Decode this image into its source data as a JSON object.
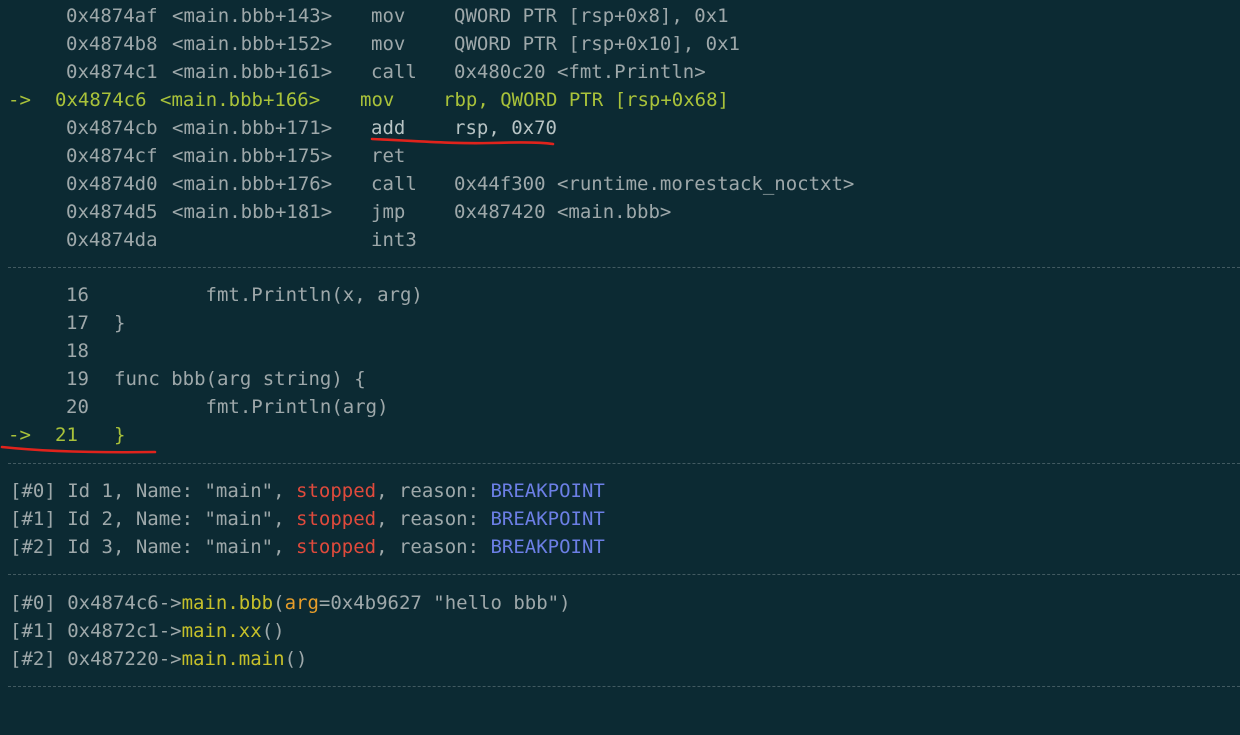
{
  "disasm": [
    {
      "arrow": "",
      "addr": "0x4874af",
      "sym": "<main.bbb+143>",
      "op": "mov",
      "args": "QWORD PTR [rsp+0x8], 0x1"
    },
    {
      "arrow": "",
      "addr": "0x4874b8",
      "sym": "<main.bbb+152>",
      "op": "mov",
      "args": "QWORD PTR [rsp+0x10], 0x1"
    },
    {
      "arrow": "",
      "addr": "0x4874c1",
      "sym": "<main.bbb+161>",
      "op": "call",
      "args": "0x480c20 <fmt.Println>"
    },
    {
      "arrow": "->",
      "addr": "0x4874c6",
      "sym": "<main.bbb+166>",
      "op": "mov",
      "args": "rbp, QWORD PTR [rsp+0x68]"
    },
    {
      "arrow": "",
      "addr": "0x4874cb",
      "sym": "<main.bbb+171>",
      "op": "add",
      "args": "rsp, 0x70"
    },
    {
      "arrow": "",
      "addr": "0x4874cf",
      "sym": "<main.bbb+175>",
      "op": "ret",
      "args": ""
    },
    {
      "arrow": "",
      "addr": "0x4874d0",
      "sym": "<main.bbb+176>",
      "op": "call",
      "args": "0x44f300 <runtime.morestack_noctxt>"
    },
    {
      "arrow": "",
      "addr": "0x4874d5",
      "sym": "<main.bbb+181>",
      "op": "jmp",
      "args": "0x487420 <main.bbb>"
    },
    {
      "arrow": "",
      "addr": "0x4874da",
      "sym": "",
      "op": "int3",
      "args": ""
    }
  ],
  "source": [
    {
      "arrow": "",
      "num": "16",
      "code": "        fmt.Println(x, arg)"
    },
    {
      "arrow": "",
      "num": "17",
      "code": "}"
    },
    {
      "arrow": "",
      "num": "18",
      "code": ""
    },
    {
      "arrow": "",
      "num": "19",
      "code": "func bbb(arg string) {"
    },
    {
      "arrow": "",
      "num": "20",
      "code": "        fmt.Println(arg)"
    },
    {
      "arrow": "->",
      "num": "21",
      "code": "}"
    }
  ],
  "threads": [
    {
      "idx": "[#0]",
      "id": "Id 1, Name: \"main\", ",
      "state": "stopped",
      "mid": ", reason: ",
      "reason": "BREAKPOINT"
    },
    {
      "idx": "[#1]",
      "id": "Id 2, Name: \"main\", ",
      "state": "stopped",
      "mid": ", reason: ",
      "reason": "BREAKPOINT"
    },
    {
      "idx": "[#2]",
      "id": "Id 3, Name: \"main\", ",
      "state": "stopped",
      "mid": ", reason: ",
      "reason": "BREAKPOINT"
    }
  ],
  "frames": [
    {
      "idx": "[#0]",
      "addr": "0x4874c6->",
      "func": "main.bbb",
      "open": "(",
      "argname": "arg",
      "argval": "=0x4b9627 \"hello bbb\")"
    },
    {
      "idx": "[#1]",
      "addr": "0x4872c1->",
      "func": "main.xx",
      "open": "()",
      "argname": "",
      "argval": ""
    },
    {
      "idx": "[#2]",
      "addr": "0x487220->",
      "func": "main.main",
      "open": "()",
      "argname": "",
      "argval": ""
    }
  ],
  "colors": {
    "background": "#0c2a33",
    "current_line": "#a9c23a",
    "stopped": "#e04a3c",
    "breakpoint": "#6c7fe6",
    "function": "#c6c02a",
    "argument": "#e79d2a",
    "annotation_underline": "#e0231c"
  }
}
